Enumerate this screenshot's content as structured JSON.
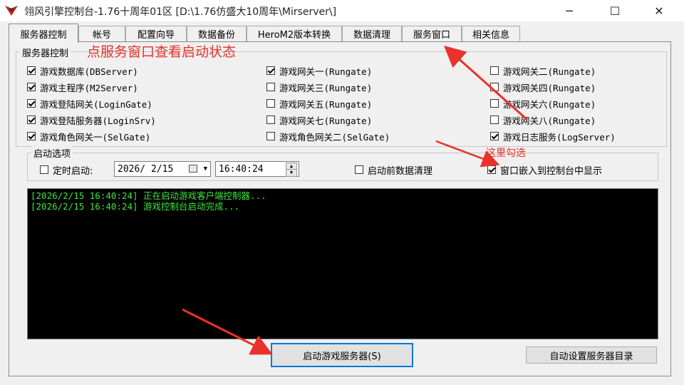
{
  "window": {
    "title": "翎风引擎控制台-1.76十周年01区 [D:\\1.76仿盛大10周年\\Mirserver\\]",
    "minimize_glyph": "─",
    "maximize_glyph": "☐",
    "close_glyph": "✕",
    "icon": "app-logo-icon"
  },
  "tabs": [
    {
      "label": "服务器控制",
      "active": true
    },
    {
      "label": "帐号"
    },
    {
      "label": "配置向导"
    },
    {
      "label": "数据备份"
    },
    {
      "label": "HeroM2版本转换"
    },
    {
      "label": "数据清理"
    },
    {
      "label": "服务窗口"
    },
    {
      "label": "相关信息"
    }
  ],
  "server_group": {
    "legend": "服务器控制",
    "annotation": "点服务窗口查看启动状态",
    "col1": [
      {
        "label": "游戏数据库(DBServer)",
        "checked": true
      },
      {
        "label": "游戏主程序(M2Server)",
        "checked": true
      },
      {
        "label": "游戏登陆网关(LoginGate)",
        "checked": true
      },
      {
        "label": "游戏登陆服务器(LoginSrv)",
        "checked": true
      },
      {
        "label": "游戏角色网关一(SelGate)",
        "checked": true
      }
    ],
    "col2": [
      {
        "label": "游戏网关一(Rungate)",
        "checked": true
      },
      {
        "label": "游戏网关三(Rungate)",
        "checked": false
      },
      {
        "label": "游戏网关五(Rungate)",
        "checked": false
      },
      {
        "label": "游戏网关七(Rungate)",
        "checked": false
      },
      {
        "label": "游戏角色网关二(SelGate)",
        "checked": false
      }
    ],
    "col3": [
      {
        "label": "游戏网关二(Rungate)",
        "checked": false
      },
      {
        "label": "游戏网关四(Rungate)",
        "checked": false
      },
      {
        "label": "游戏网关六(Rungate)",
        "checked": false
      },
      {
        "label": "游戏网关八(Rungate)",
        "checked": false
      },
      {
        "label": "游戏日志服务(LogServer)",
        "checked": true
      }
    ]
  },
  "start_options": {
    "legend": "启动选项",
    "timed_start_label": "定时启动:",
    "timed_start_checked": false,
    "date_value": "2026/ 2/15",
    "time_value": "16:40:24",
    "clean_data_label": "启动前数据清理",
    "clean_data_checked": false,
    "embed_window_label": "窗口嵌入到控制台中显示",
    "embed_window_checked": true,
    "annotation": "这里勾选"
  },
  "console": {
    "lines": [
      "[2026/2/15 16:40:24] 正在启动游戏客户端控制器...",
      "[2026/2/15 16:40:24] 游戏控制台启动完成..."
    ],
    "text_color": "#3ee63e",
    "background": "#000000"
  },
  "buttons": {
    "start_server": "启动游戏服务器(S)",
    "auto_set_dir": "自动设置服务器目录"
  },
  "colors": {
    "annotation": "#e8322a",
    "focus": "#0078d7"
  }
}
